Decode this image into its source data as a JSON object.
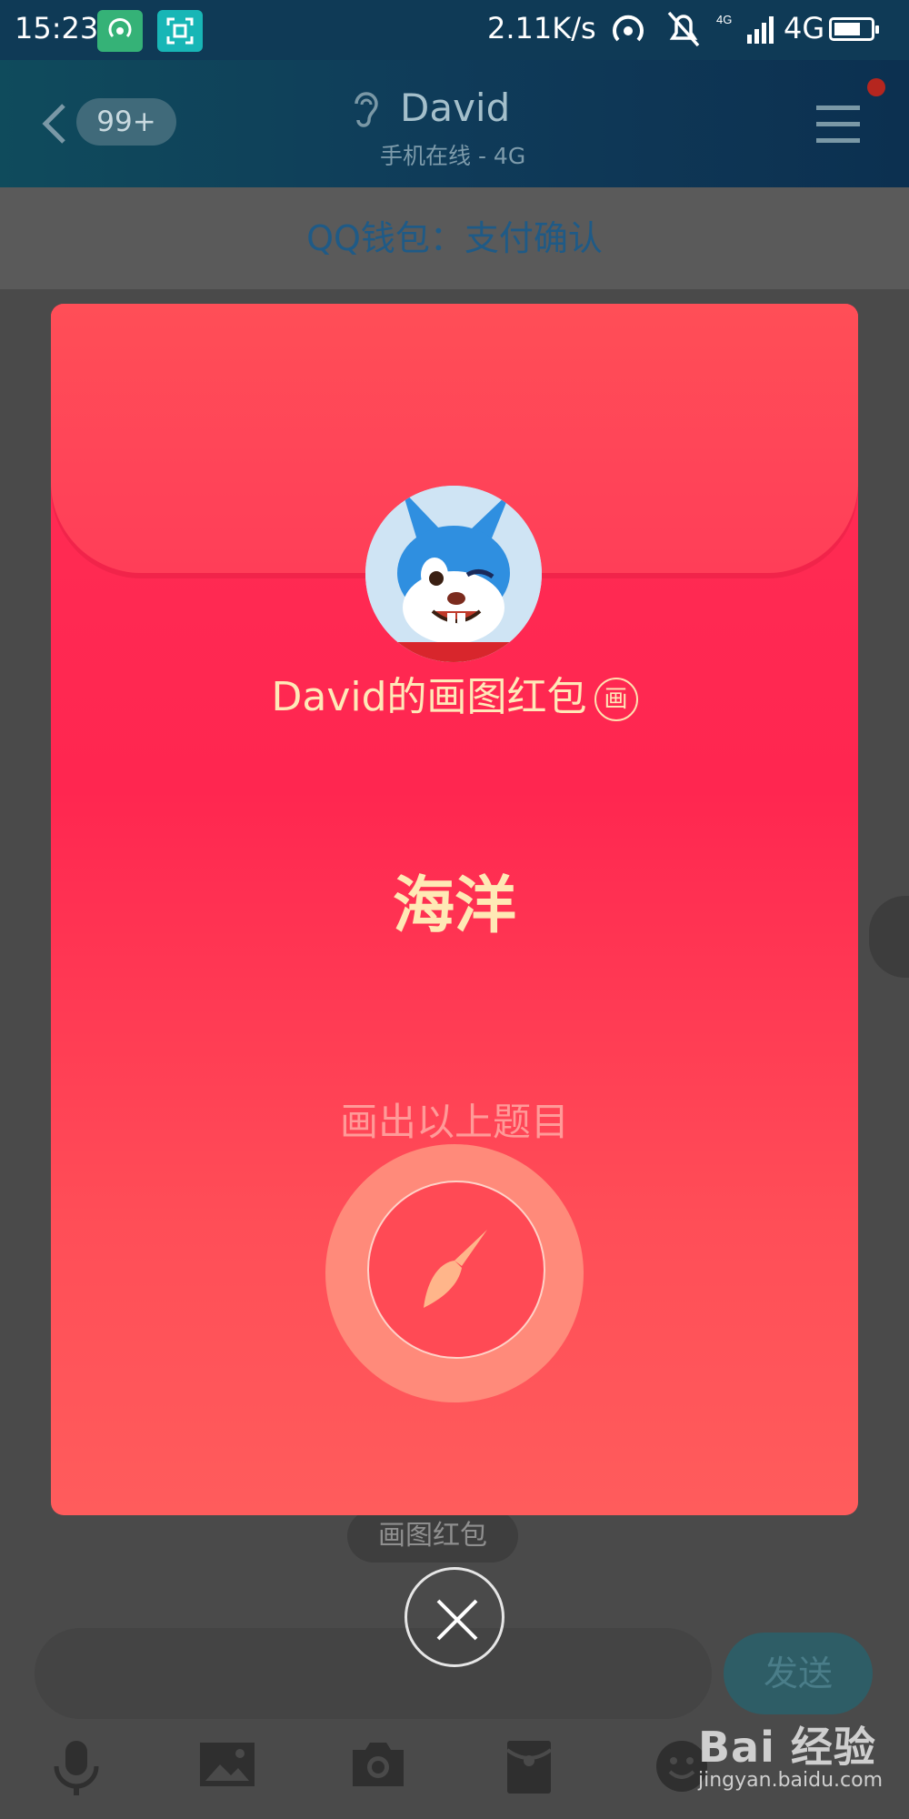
{
  "status_bar": {
    "time": "15:23",
    "speed": "2.11K/s",
    "network": "4G",
    "icons": [
      "hotspot-app-icon",
      "scan-app-icon",
      "hotspot-icon",
      "mute-bell-icon",
      "signal-icon",
      "battery-icon"
    ]
  },
  "header": {
    "unread_count": "99+",
    "contact_name": "David",
    "contact_status": "手机在线 - 4G"
  },
  "subtitle": "QQ钱包：支付确认",
  "red_packet": {
    "title": "David的画图红包",
    "badge": "画",
    "topic": "海洋",
    "hint": "画出以上题目",
    "colors": {
      "card": "#ff2e55",
      "text": "#ffe8b8",
      "button": "#ff8a7a"
    }
  },
  "chat": {
    "message_label": "画图红包"
  },
  "input": {
    "send_label": "发送"
  },
  "toolbar": {
    "icons": [
      "microphone-icon",
      "image-icon",
      "camera-icon",
      "red-packet-icon",
      "emoji-icon"
    ]
  },
  "watermark": {
    "brand": "Bai 经验",
    "url": "jingyan.baidu.com"
  }
}
